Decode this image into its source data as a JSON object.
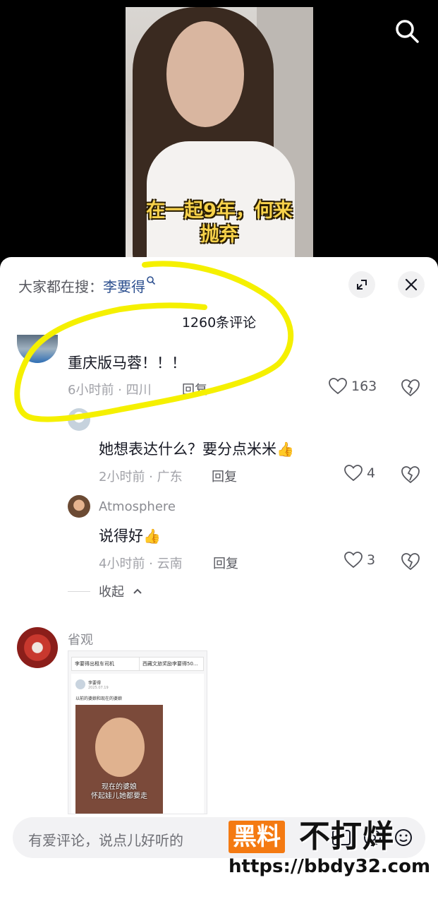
{
  "video": {
    "caption_line1": "在一起9年，何来",
    "caption_line2": "抛弃"
  },
  "sheet": {
    "hot_search_prefix": "大家都在搜：",
    "hot_search_keyword": "李要得",
    "comment_count": "1260条评论",
    "collapse_label": "收起"
  },
  "comments": [
    {
      "username": "",
      "text": "重庆版马蓉！！！",
      "time": "6小时前",
      "location": "四川",
      "reply_label": "回复",
      "likes": "163"
    }
  ],
  "replies": [
    {
      "username": "",
      "text": "她想表达什么？要分点米米",
      "emoji": "👍",
      "time": "2小时前",
      "location": "广东",
      "reply_label": "回复",
      "likes": "4"
    },
    {
      "username": "Atmosphere",
      "text": "说得好",
      "emoji": "👍",
      "time": "4小时前",
      "location": "云南",
      "reply_label": "回复",
      "likes": "3"
    }
  ],
  "image_comment": {
    "username": "省观",
    "image_content": {
      "tab1": "李要得出租车司机",
      "tab2": "西藏文旅奖励李要得50...",
      "author": "李要得",
      "date": "2025.07.19",
      "post_text": "以前的婆娘和现在的婆娘",
      "caption_line1": "现在的婆娘",
      "caption_line2": "怀起娃儿她都要走"
    }
  },
  "input_bar": {
    "placeholder": "有爱评论，说点儿好听的"
  },
  "watermark": {
    "badge": "黑料",
    "text": "不打烊",
    "url": "https://bbdy32.com"
  },
  "colors": {
    "caption_yellow": "#f7d24b",
    "annotation_yellow": "#f5f000",
    "keyword_blue": "#2c4f8f",
    "watermark_orange": "#f47a12"
  }
}
